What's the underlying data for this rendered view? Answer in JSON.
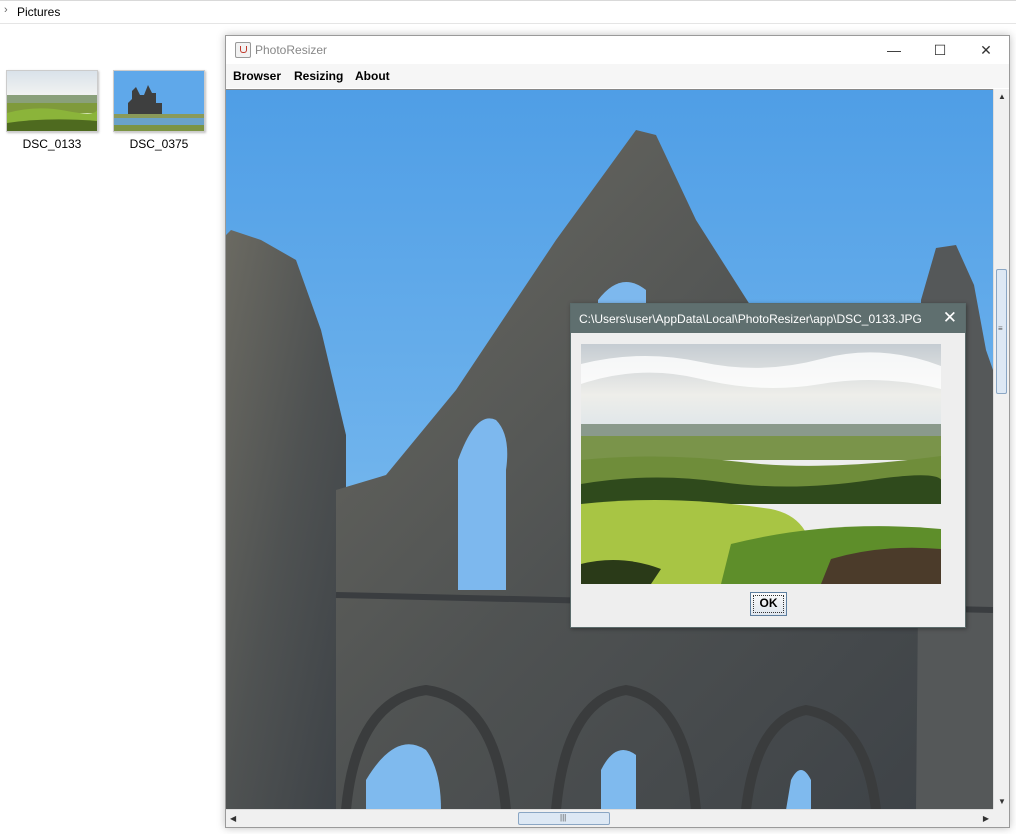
{
  "explorer": {
    "breadcrumb": "Pictures",
    "files": [
      {
        "name": "DSC_0133"
      },
      {
        "name": "DSC_0375"
      }
    ]
  },
  "app": {
    "title": "PhotoResizer",
    "menu": [
      "Browser",
      "Resizing",
      "About"
    ],
    "window_controls": {
      "minimize": "minimize-icon",
      "maximize": "maximize-icon",
      "close": "close-icon"
    }
  },
  "dialog": {
    "title": "C:\\Users\\user\\AppData\\Local\\PhotoResizer\\app\\DSC_0133.JPG",
    "ok_label": "OK"
  },
  "colors": {
    "sky": "#6fb3ef",
    "stone": "#5a5c5c",
    "dialog_title_bg": "#5f6f6f",
    "grass": "#6c9a2c"
  }
}
